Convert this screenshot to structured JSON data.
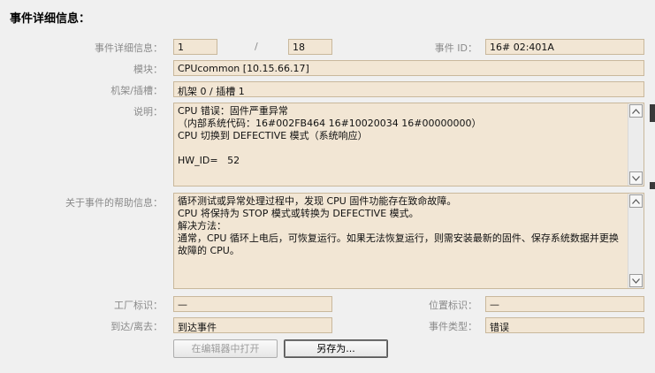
{
  "section_title": "事件详细信息：",
  "labels": {
    "event_detail": "事件详细信息：",
    "event_id": "事件 ID：",
    "module": "模块：",
    "rack_slot": "机架/插槽：",
    "description": "说明：",
    "help": "关于事件的帮助信息：",
    "plant_id": "工厂标识：",
    "location_id": "位置标识：",
    "arrive_leave": "到达/离去：",
    "event_type": "事件类型："
  },
  "values": {
    "event_index": "1",
    "separator": "/",
    "event_total": "18",
    "event_id": "16# 02:401A",
    "module": "CPUcommon [10.15.66.17]",
    "rack_slot": "机架 0 / 插槽 1",
    "description": "CPU 错误：固件严重异常\n（内部系统代码：16#002FB464 16#10020034 16#00000000）\nCPU 切换到 DEFECTIVE 模式（系统响应）\n\nHW_ID=   52",
    "help": "循环测试或异常处理过程中，发现 CPU 固件功能存在致命故障。\nCPU 将保持为 STOP 模式或转换为 DEFECTIVE 模式。\n解决方法：\n通常，CPU 循环上电后，可恢复运行。如果无法恢复运行，则需安装最新的固件、保存系统数据并更换故障的 CPU。",
    "plant_id": "—",
    "location_id": "—",
    "arrive_leave": "到达事件",
    "event_type": "错误"
  },
  "buttons": {
    "open_in_editor": "在编辑器中打开",
    "save_as": "另存为..."
  },
  "icons": {
    "scroll_up": "scroll-up-arrow-icon",
    "scroll_down": "scroll-down-arrow-icon"
  },
  "colors": {
    "field_bg": "#f2e6d4",
    "field_border": "#c9b89c",
    "label": "#8a8a8a"
  }
}
